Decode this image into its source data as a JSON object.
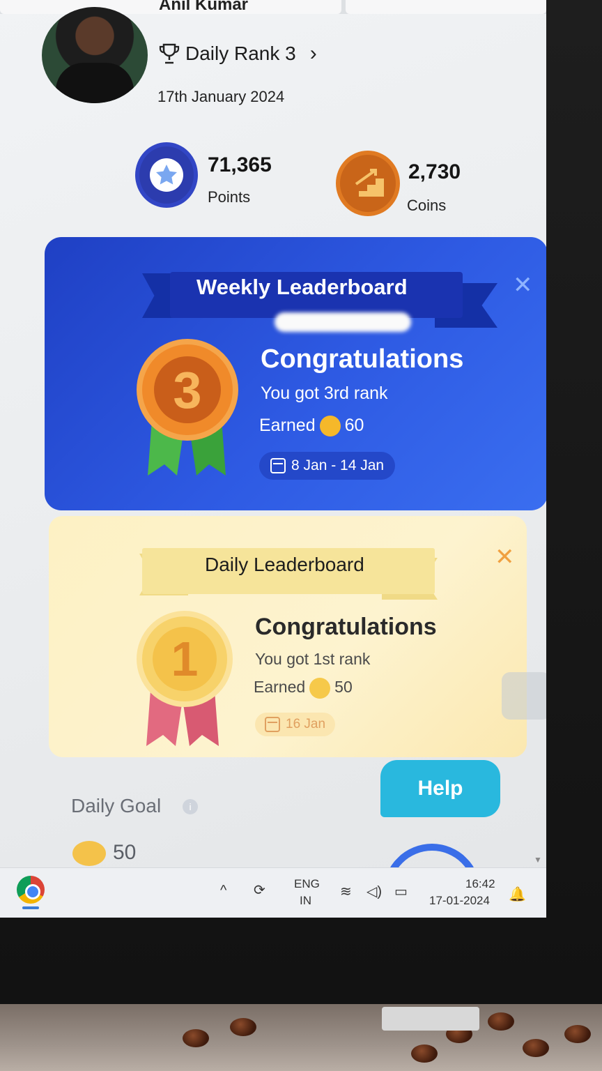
{
  "profile": {
    "name": "Anil Kumar",
    "rank_label": "Daily Rank 3",
    "date": "17th January 2024"
  },
  "stats": {
    "points": {
      "value": "71,365",
      "label": "Points",
      "icon": "star-icon"
    },
    "coins": {
      "value": "2,730",
      "label": "Coins",
      "icon": "stairs-arrow-icon"
    }
  },
  "weekly_card": {
    "title": "Weekly Leaderboard",
    "medal_number": "3",
    "congrats": "Congratulations",
    "rank_text": "You got 3rd rank",
    "earned_label": "Earned",
    "earned_value": "60",
    "date_range": "8 Jan - 14 Jan",
    "close_symbol": "✕"
  },
  "daily_card": {
    "title": "Daily Leaderboard",
    "medal_number": "1",
    "congrats": "Congratulations",
    "rank_text": "You got 1st rank",
    "earned_label": "Earned",
    "earned_value": "50",
    "date_range": "16 Jan",
    "close_symbol": "✕"
  },
  "daily_goal": {
    "title": "Daily Goal",
    "info": "i",
    "value": "50"
  },
  "help_button": {
    "label": "Help"
  },
  "taskbar": {
    "language_top": "ENG",
    "language_bottom": "IN",
    "time": "16:42",
    "date": "17-01-2024",
    "chevron": "^"
  },
  "colors": {
    "weekly_bg": "#2e5ae3",
    "daily_bg": "#fdf1c4",
    "help_bg": "#29b8de",
    "bronze_medal": "#e07a22",
    "gold_medal": "#f4c24a"
  }
}
